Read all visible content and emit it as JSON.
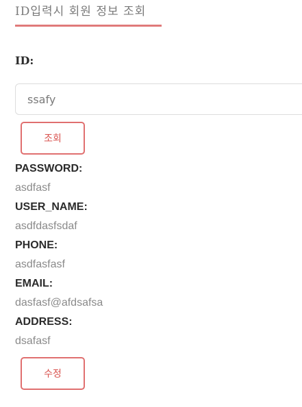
{
  "header": {
    "title": "ID입력시 회원 정보 조회"
  },
  "search": {
    "id_label": "ID:",
    "id_value": "ssafy",
    "search_button": "조회"
  },
  "member": {
    "password_label": "PASSWORD:",
    "password_value": "asdfasf",
    "user_name_label": "USER_NAME:",
    "user_name_value": "asdfdasfsdaf",
    "phone_label": "PHONE:",
    "phone_value": "asdfasfasf",
    "email_label": "EMAIL:",
    "email_value": "dasfasf@afdsafsa",
    "address_label": "ADDRESS:",
    "address_value": "dsafasf"
  },
  "actions": {
    "edit_button": "수정"
  },
  "colors": {
    "accent": "#e07a7a",
    "button_text": "#d9534f"
  }
}
